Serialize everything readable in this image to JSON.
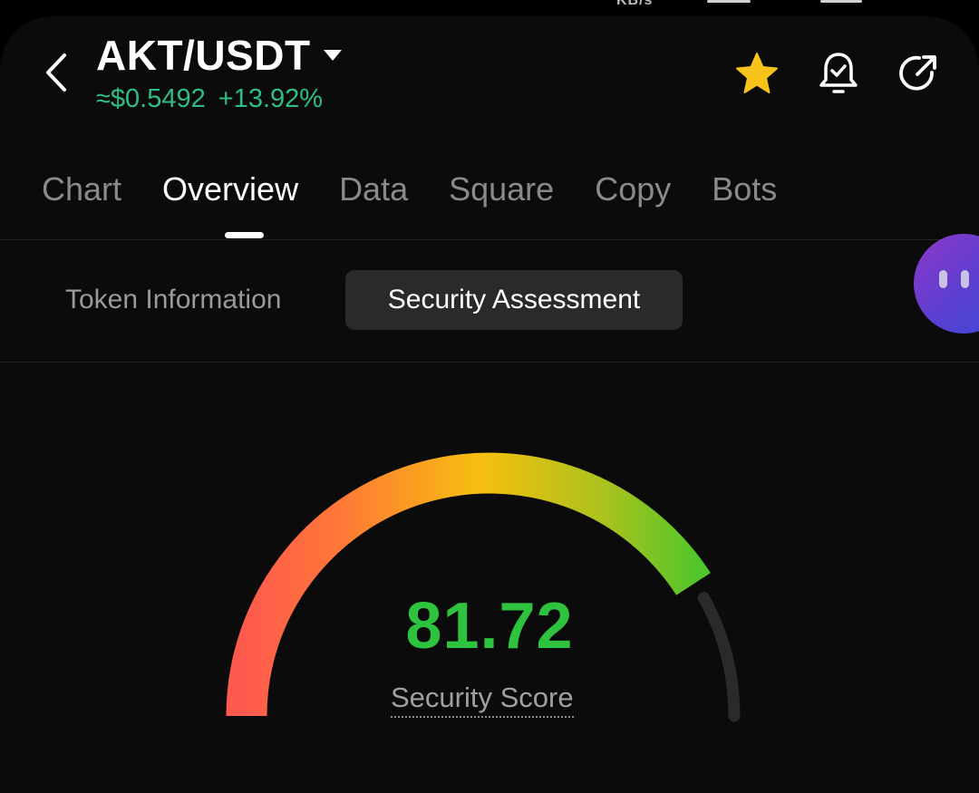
{
  "status_bar": {
    "net_speed": "KB/s"
  },
  "header": {
    "pair": "AKT/USDT",
    "price": "≈$0.5492",
    "change": "+13.92%",
    "icons": [
      "back-arrow-icon",
      "star-icon",
      "bell-check-icon",
      "share-icon"
    ]
  },
  "tabs": [
    {
      "label": "Chart",
      "active": false
    },
    {
      "label": "Overview",
      "active": true
    },
    {
      "label": "Data",
      "active": false
    },
    {
      "label": "Square",
      "active": false
    },
    {
      "label": "Copy",
      "active": false
    },
    {
      "label": "Bots",
      "active": false
    }
  ],
  "subtabs": [
    {
      "label": "Token Information",
      "active": false
    },
    {
      "label": "Security Assessment",
      "active": true
    }
  ],
  "security": {
    "score": "81.72",
    "score_value": 81.72,
    "score_max": 100,
    "label": "Security Score"
  },
  "colors": {
    "price_green": "#2ebd85",
    "score_green": "#2ec33f",
    "star_yellow": "#f7c31a",
    "gauge_start": "#ff5a4e",
    "gauge_mid": "#f6bf10",
    "gauge_end": "#52c52a",
    "gauge_track": "#2a2a2c"
  }
}
